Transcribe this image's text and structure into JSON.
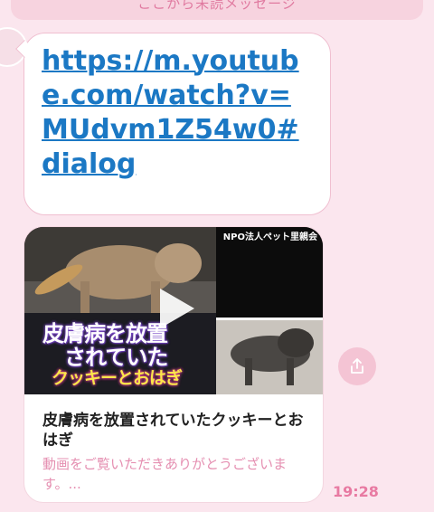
{
  "banner": {
    "text": "ここから未読メッセージ"
  },
  "message": {
    "link_text": "https://m.youtube.com/watch?v=MUdvm1Z54w0#dialog"
  },
  "preview": {
    "thumbnail": {
      "org_label": "NPO法人ペット里親会",
      "caption_line1": "皮膚病を放置",
      "caption_line2": "されていた",
      "caption_line3": "クッキーとおはぎ"
    },
    "title": "皮膚病を放置されていたクッキーとおはぎ",
    "description": "動画をご覧いただきありがとうございます。..."
  },
  "timestamp": "19:28",
  "colors": {
    "background": "#fbe6ee",
    "link": "#1b78c4",
    "accent_pink": "#e87aa2"
  },
  "icons": {
    "share": "share-icon",
    "play": "play-icon"
  }
}
